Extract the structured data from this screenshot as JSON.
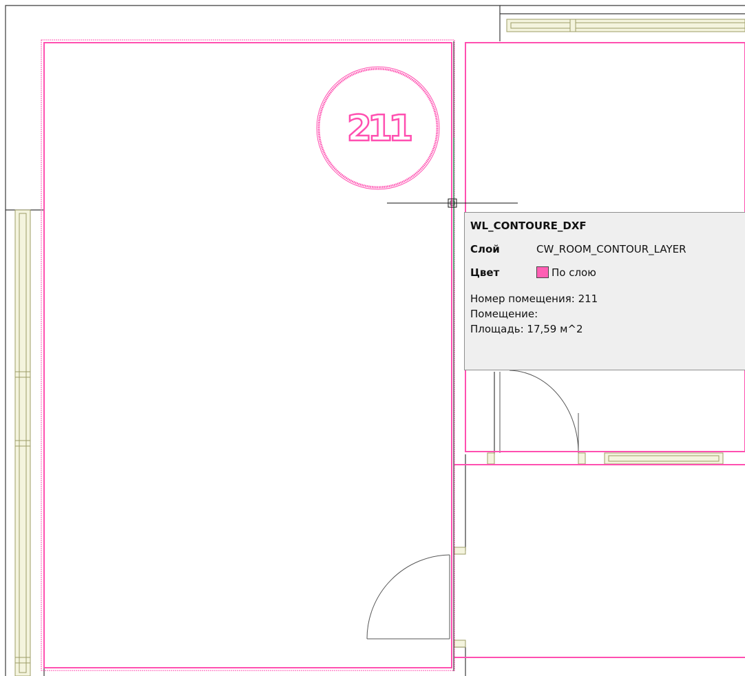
{
  "room_tag": {
    "number": "211"
  },
  "tooltip": {
    "title": "WL_CONTOURE_DXF",
    "layer_label": "Слой",
    "layer_value": "CW_ROOM_CONTOUR_LAYER",
    "color_label": "Цвет",
    "color_value": "По слою",
    "color_swatch": "#ff5fb4",
    "room_number_line": "Номер помещения: 211",
    "room_name_line": "Помещение:",
    "area_line": "Площадь: 17,59 м^2"
  },
  "colors": {
    "room_contour": "#ff4fb0",
    "wall": "#3a3a3a",
    "window": "#b8b87a"
  }
}
